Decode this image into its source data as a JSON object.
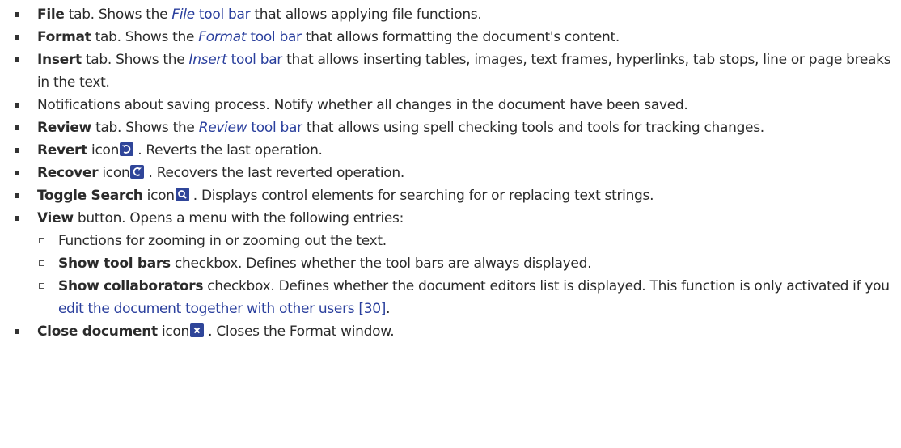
{
  "items": [
    {
      "bold": "File",
      "before": " tab. Shows the ",
      "link_italic": "File",
      "link_text": " tool bar",
      "after": " that allows applying file functions."
    },
    {
      "bold": "Format",
      "before": " tab. Shows the ",
      "link_italic": "Format",
      "link_text": " tool bar",
      "after": " that allows formatting the document's content."
    },
    {
      "bold": "Insert",
      "before": " tab. Shows the ",
      "link_italic": "Insert",
      "link_text": " tool bar",
      "after": " that allows inserting tables, images, text frames, hyperlinks, tab stops, line or page breaks in the text."
    },
    {
      "text": "Notifications about saving process. Notify whether all changes in the document have been saved."
    },
    {
      "bold": "Review",
      "before": " tab. Shows the ",
      "link_italic": "Review",
      "link_text": " tool bar",
      "after": " that allows using spell checking tools and tools for tracking changes."
    },
    {
      "bold": "Revert",
      "before": " icon",
      "icon": "revert-icon",
      "after": " . Reverts the last operation."
    },
    {
      "bold": "Recover",
      "before": " icon",
      "icon": "recover-icon",
      "after": " . Recovers the last reverted operation."
    },
    {
      "bold": "Toggle Search",
      "before": " icon",
      "icon": "search-icon",
      "after": " . Displays control elements for searching for or replacing text strings."
    },
    {
      "bold": "View",
      "after": " button. Opens a menu with the following entries:"
    }
  ],
  "view_sub": [
    {
      "text": "Functions for zooming in or zooming out the text."
    },
    {
      "bold": "Show tool bars",
      "after": " checkbox. Defines whether the tool bars are always displayed."
    },
    {
      "bold": "Show collaborators",
      "after": " checkbox. Defines whether the document editors list is displayed. This function is only activated if you ",
      "link_text": "edit the document together with other users [30]",
      "end": "."
    }
  ],
  "last": {
    "bold": "Close document",
    "before": " icon",
    "icon": "close-icon",
    "after": " . Closes the Format window."
  },
  "colors": {
    "link": "#2a3f9d",
    "icon_bg": "#2f4599",
    "text": "#2b2b2b"
  }
}
